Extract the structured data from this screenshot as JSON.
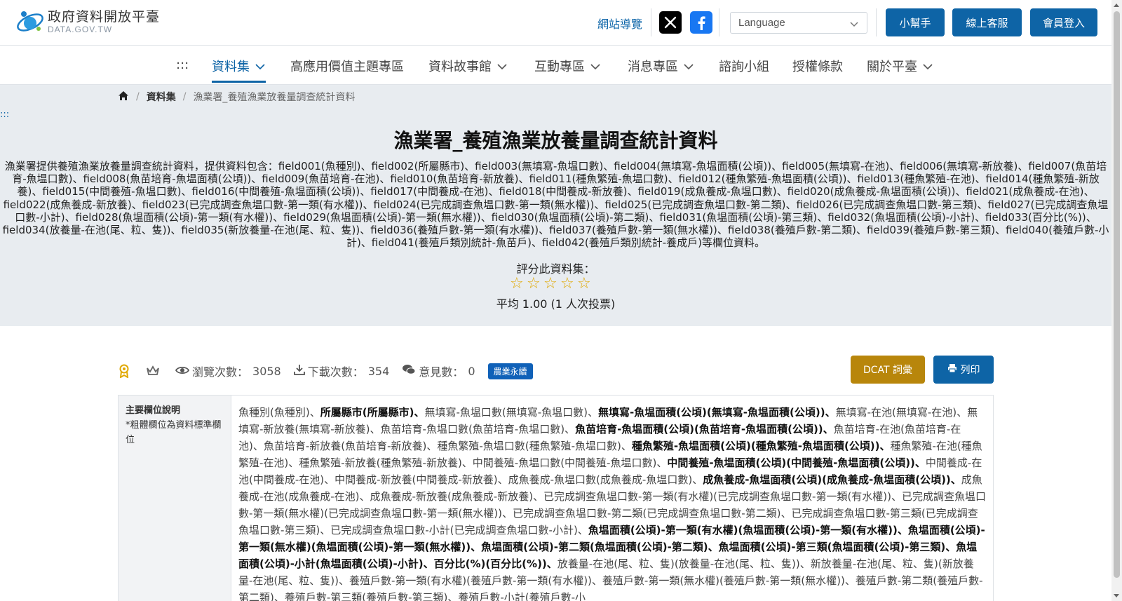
{
  "header": {
    "logo_title": "政府資料開放平臺",
    "logo_sub": "DATA.GOV.TW",
    "sitemap": "網站導覽",
    "language_placeholder": "Language",
    "btn_helper": "小幫手",
    "btn_support": "線上客服",
    "btn_login": "會員登入"
  },
  "nav": {
    "dots": ":::",
    "items": [
      "資料集",
      "高應用價值主題專區",
      "資料故事館",
      "互動專區",
      "消息專區",
      "諮詢小組",
      "授權條款",
      "關於平臺"
    ]
  },
  "breadcrumb": {
    "level1": "資料集",
    "current": "漁業署_養殖漁業放養量調查統計資料"
  },
  "hero": {
    "dots": ":::",
    "title": "漁業署_養殖漁業放養量調查統計資料",
    "description": "漁業署提供養殖漁業放養量調查統計資料，提供資料包含：field001(魚種別)、field002(所屬縣市)、field003(無填寫-魚塭口數)、field004(無填寫-魚塭面積(公頃))、field005(無填寫-在池)、field006(無填寫-新放養)、field007(魚苗培育-魚塭口數)、field008(魚苗培育-魚塭面積(公頃))、field009(魚苗培育-在池)、field010(魚苗培育-新放養)、field011(種魚繁殖-魚塭口數)、field012(種魚繁殖-魚塭面積(公頃))、field013(種魚繁殖-在池)、field014(種魚繁殖-新放養)、field015(中間養殖-魚塭口數)、field016(中間養殖-魚塭面積(公頃))、field017(中間養成-在池)、field018(中間養成-新放養)、field019(成魚養成-魚塭口數)、field020(成魚養成-魚塭面積(公頃))、field021(成魚養成-在池)、field022(成魚養成-新放養)、field023(已完成調查魚塭口數-第一類(有水權))、field024(已完成調查魚塭口數-第一類(無水權))、field025(已完成調查魚塭口數-第二類)、field026(已完成調查魚塭口數-第三類)、field027(已完成調查魚塭口數-小計)、field028(魚塭面積(公頃)-第一類(有水權))、field029(魚塭面積(公頃)-第一類(無水權))、field030(魚塭面積(公頃)-第二類)、field031(魚塭面積(公頃)-第三類)、field032(魚塭面積(公頃)-小計)、field033(百分比(%))、field034(放養量-在池(尾、粒、隻))、field035(新放養量-在池(尾、粒、隻))、field036(養殖戶數-第一類(有水權))、field037(養殖戶數-第一類(無水權))、field038(養殖戶數-第二類)、field039(養殖戶數-第三類)、field040(養殖戶數-小計)、field041(養殖戶類別統計-魚苗戶)、field042(養殖戶類別統計-養成戶)等欄位資料。",
    "rate_label": "評分此資料集：",
    "rating_value": 0,
    "average": "平均 1.00 (1 人次投票)"
  },
  "stats": {
    "views_label": "瀏覽次數：",
    "views": "3058",
    "downloads_label": "下載次數：",
    "downloads": "354",
    "comments_label": "意見數：",
    "comments": "0",
    "tag": "農業永續",
    "btn_dcat": "DCAT 詞彙",
    "btn_print": "列印"
  },
  "fields": {
    "head_title": "主要欄位說明",
    "head_note": "*粗體欄位為資料標準欄位",
    "segments": [
      {
        "t": "魚種別(魚種別)、",
        "b": false
      },
      {
        "t": "所屬縣市(所屬縣市)、",
        "b": true
      },
      {
        "t": "無填寫-魚塭口數(無填寫-魚塭口數)、",
        "b": false
      },
      {
        "t": "無填寫-魚塭面積(公頃)(無填寫-魚塭面積(公頃))、",
        "b": true
      },
      {
        "t": "無填寫-在池(無填寫-在池)、無填寫-新放養(無填寫-新放養)、魚苗培育-魚塭口數(魚苗培育-魚塭口數)、",
        "b": false
      },
      {
        "t": "魚苗培育-魚塭面積(公頃)(魚苗培育-魚塭面積(公頃))、",
        "b": true
      },
      {
        "t": "魚苗培育-在池(魚苗培育-在池)、魚苗培育-新放養(魚苗培育-新放養)、種魚繁殖-魚塭口數(種魚繁殖-魚塭口數)、",
        "b": false
      },
      {
        "t": "種魚繁殖-魚塭面積(公頃)(種魚繁殖-魚塭面積(公頃))、",
        "b": true
      },
      {
        "t": "種魚繁殖-在池(種魚繁殖-在池)、種魚繁殖-新放養(種魚繁殖-新放養)、中間養殖-魚塭口數(中間養殖-魚塭口數)、",
        "b": false
      },
      {
        "t": "中間養殖-魚塭面積(公頃)(中間養殖-魚塭面積(公頃))、",
        "b": true
      },
      {
        "t": "中間養成-在池(中間養成-在池)、中間養成-新放養(中間養成-新放養)、成魚養成-魚塭口數(成魚養成-魚塭口數)、",
        "b": false
      },
      {
        "t": "成魚養成-魚塭面積(公頃)(成魚養成-魚塭面積(公頃))、",
        "b": true
      },
      {
        "t": "成魚養成-在池(成魚養成-在池)、成魚養成-新放養(成魚養成-新放養)、已完成調查魚塭口數-第一類(有水權)(已完成調查魚塭口數-第一類(有水權))、已完成調查魚塭口數-第一類(無水權)(已完成調查魚塭口數-第一類(無水權))、已完成調查魚塭口數-第二類(已完成調查魚塭口數-第二類)、已完成調查魚塭口數-第三類(已完成調查魚塭口數-第三類)、已完成調查魚塭口數-小計(已完成調查魚塭口數-小計)、",
        "b": false
      },
      {
        "t": "魚塭面積(公頃)-第一類(有水權)(魚塭面積(公頃)-第一類(有水權))、魚塭面積(公頃)-第一類(無水權)(魚塭面積(公頃)-第一類(無水權))、魚塭面積(公頃)-第二類(魚塭面積(公頃)-第二類)、魚塭面積(公頃)-第三類(魚塭面積(公頃)-第三類)、魚塭面積(公頃)-小計(魚塭面積(公頃)-小計)、百分比(%)(百分比(%))、",
        "b": true
      },
      {
        "t": "放養量-在池(尾、粒、隻)(放養量-在池(尾、粒、隻))、新放養量-在池(尾、粒、隻)(新放養量-在池(尾、粒、隻))、養殖戶數-第一類(有水權)(養殖戶數-第一類(有水權))、養殖戶數-第一類(無水權)(養殖戶數-第一類(無水權))、養殖戶數-第二類(養殖戶數-第二類)、養殖戶數-第三類(養殖戶數-第三類)、養殖戶數-小計(養殖戶數-小",
        "b": false
      }
    ]
  },
  "colors": {
    "primary": "#0e64a6",
    "dcat": "#b8860b",
    "tag": "#1061b8",
    "hero_bg": "#e8ecf0",
    "star": "#e0a800"
  }
}
